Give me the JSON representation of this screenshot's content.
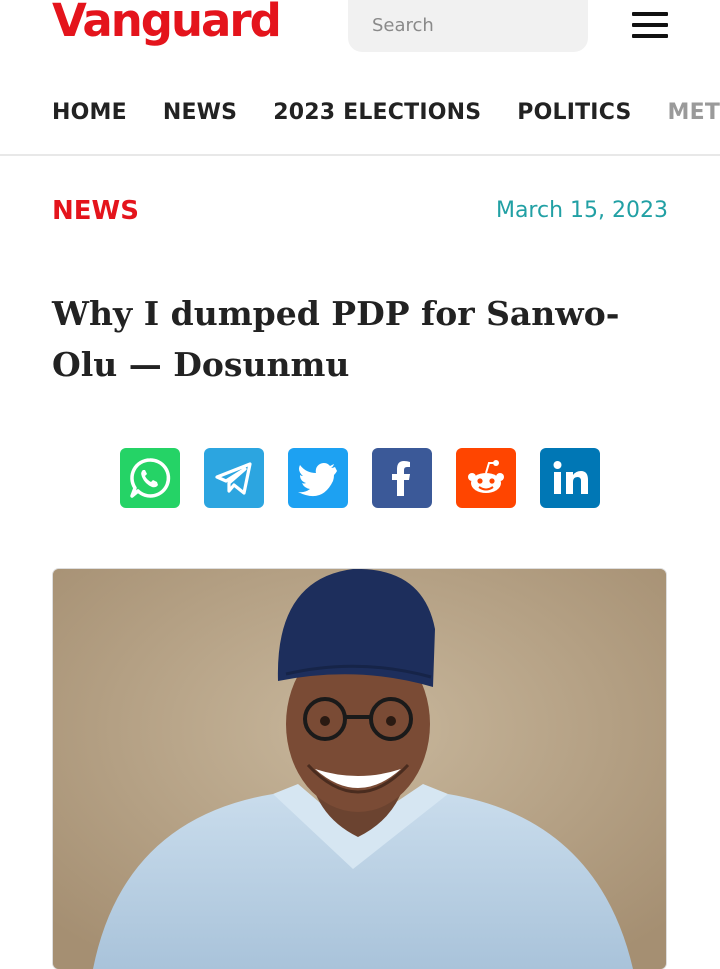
{
  "header": {
    "logo_text": "Vanguard",
    "search": {
      "placeholder": "Search",
      "button_icon": "search-icon"
    },
    "menu_icon": "hamburger-menu-icon"
  },
  "nav": {
    "items": [
      {
        "label": "HOME"
      },
      {
        "label": "NEWS"
      },
      {
        "label": "2023 ELECTIONS"
      },
      {
        "label": "POLITICS"
      },
      {
        "label": "METRO"
      }
    ]
  },
  "article": {
    "category": "NEWS",
    "date": "March 15, 2023",
    "headline": "Why I dumped PDP for Sanwo-Olu — Dosunmu",
    "share_buttons": [
      {
        "name": "whatsapp",
        "icon": "whatsapp-icon",
        "color": "#25d366"
      },
      {
        "name": "telegram",
        "icon": "telegram-icon",
        "color": "#2ca5e0"
      },
      {
        "name": "twitter",
        "icon": "twitter-icon",
        "color": "#1da1f2"
      },
      {
        "name": "facebook",
        "icon": "facebook-icon",
        "color": "#3b5998"
      },
      {
        "name": "reddit",
        "icon": "reddit-icon",
        "color": "#ff4500"
      },
      {
        "name": "linkedin",
        "icon": "linkedin-icon",
        "color": "#0077b5"
      }
    ],
    "image": {
      "subject": "portrait-photo"
    }
  },
  "colors": {
    "brand": "#e4141c",
    "date": "#21a0a4",
    "text": "#222222"
  }
}
